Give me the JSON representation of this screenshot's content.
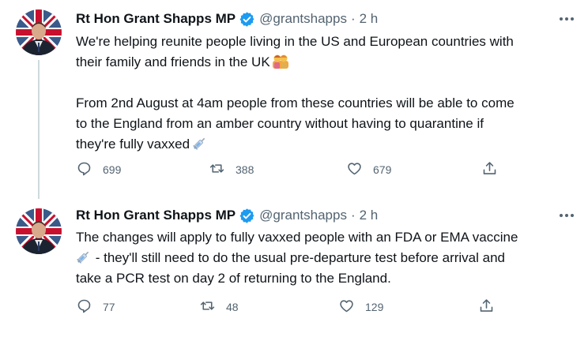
{
  "tweets": [
    {
      "name": "Rt Hon Grant Shapps MP",
      "handle": "@grantshapps",
      "separator": "·",
      "time": "2 h",
      "text_lines": [
        "We're helping reunite people living in the US and European countries with",
        "their family and friends in the UK"
      ],
      "text_lines_2": [
        "From 2nd August at 4am people from these countries will be able to come",
        "to the England from an amber country without having to quarantine if",
        "they're fully vaxxed"
      ],
      "emoji_1": "family-emoji",
      "emoji_2": "syringe-emoji",
      "replies": "699",
      "retweets": "388",
      "likes": "679"
    },
    {
      "name": "Rt Hon Grant Shapps MP",
      "handle": "@grantshapps",
      "separator": "·",
      "time": "2 h",
      "text_line_1": "The changes will apply to fully vaxxed people with an FDA or EMA vaccine",
      "text_line_2": " - they'll still need to do the usual pre-departure test before arrival and",
      "text_line_3": "take a PCR test on day 2 of returning to the England.",
      "emoji_1": "syringe-emoji",
      "replies": "77",
      "retweets": "48",
      "likes": "129"
    }
  ],
  "colors": {
    "text": "#0f1419",
    "secondary": "#536471",
    "verified": "#1d9bf0",
    "thread_line": "#cfd9de"
  }
}
